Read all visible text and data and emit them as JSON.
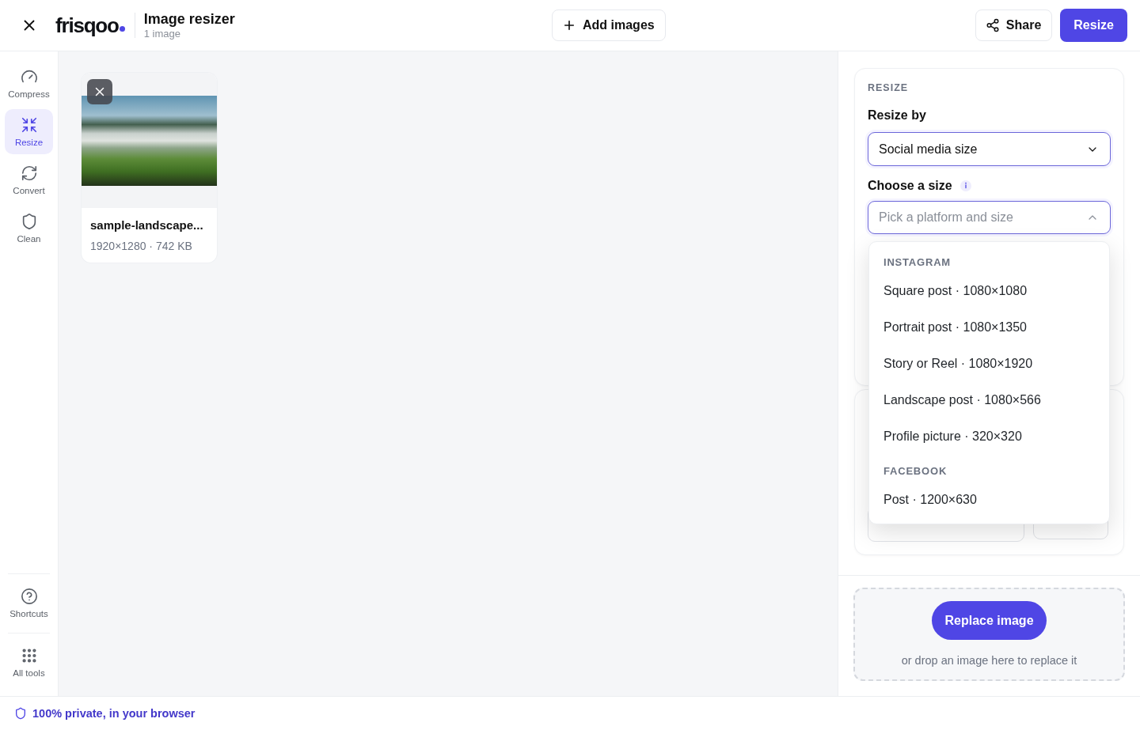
{
  "header": {
    "logo": "frisqoo",
    "title": "Image resizer",
    "subtitle": "1 image",
    "add_button": "Add images",
    "share_button": "Share",
    "resize_button": "Resize"
  },
  "sidebar": {
    "items": [
      {
        "kind": "gauge",
        "label": "Compress",
        "selected": false
      },
      {
        "kind": "shrink",
        "label": "Resize",
        "selected": true
      },
      {
        "kind": "refresh",
        "label": "Convert",
        "selected": false
      },
      {
        "kind": "shield",
        "label": "Clean",
        "selected": false
      }
    ],
    "bottom_items": [
      {
        "kind": "help",
        "label": "Shortcuts"
      },
      {
        "kind": "grid",
        "label": "All tools"
      }
    ]
  },
  "images": [
    {
      "name": "sample-landscape...",
      "meta": "1920×1280 · 742 KB"
    }
  ],
  "panel": {
    "section_title": "RESIZE",
    "resize_by": {
      "label": "Resize by",
      "value": "Social media size",
      "expanded": false
    },
    "choose_size": {
      "label": "Choose a size",
      "placeholder": "Pick a platform and size",
      "expanded": true,
      "options": [
        {
          "kind": "group",
          "label": "INSTAGRAM"
        },
        {
          "kind": "option",
          "label": "Square post · 1080×1080",
          "selected": false
        },
        {
          "kind": "option",
          "label": "Portrait post · 1080×1350",
          "selected": false
        },
        {
          "kind": "option",
          "label": "Story or Reel · 1080×1920",
          "selected": false
        },
        {
          "kind": "option",
          "label": "Landscape post · 1080×566",
          "selected": false
        },
        {
          "kind": "option",
          "label": "Profile picture · 320×320",
          "selected": false
        },
        {
          "kind": "group",
          "label": "FACEBOOK"
        },
        {
          "kind": "option",
          "label": "Post · 1200×630",
          "selected": false
        }
      ]
    }
  },
  "drop_zone": {
    "button": "Replace image",
    "hint": "or drop an image here to replace it"
  },
  "footer": {
    "text": "100% private, in your browser"
  }
}
